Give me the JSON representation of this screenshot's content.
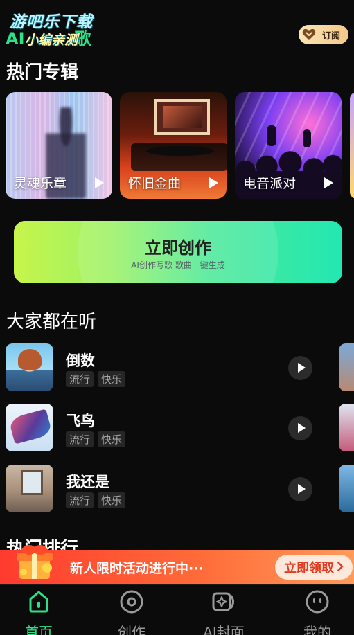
{
  "header": {
    "logo_line1": "游吧乐下载",
    "logo_line2": "AI",
    "logo_line2_suffix": "歌",
    "logo_line3": "小编亲测",
    "subscribe_label": "订阅"
  },
  "albums_section": {
    "title": "热门专辑",
    "items": [
      {
        "name": "灵魂乐章"
      },
      {
        "name": "怀旧金曲"
      },
      {
        "name": "电音派对"
      }
    ]
  },
  "create_card": {
    "title": "立即创作",
    "subtitle": "AI创作写歌 歌曲一键生成"
  },
  "listening_section": {
    "title": "大家都在听",
    "songs": [
      {
        "title": "倒数",
        "tags": [
          "流行",
          "快乐"
        ]
      },
      {
        "title": "飞鸟",
        "tags": [
          "流行",
          "快乐"
        ]
      },
      {
        "title": "我还是",
        "tags": [
          "流行",
          "快乐"
        ]
      }
    ]
  },
  "ranking_section": {
    "title": "热门排行"
  },
  "promo": {
    "text": "新人限时活动进行中···",
    "cta_label": "立即领取"
  },
  "nav": {
    "items": [
      {
        "label": "首页",
        "icon": "home-icon",
        "active": true
      },
      {
        "label": "创作",
        "icon": "disc-icon",
        "active": false
      },
      {
        "label": "AI封面",
        "icon": "ai-cover-icon",
        "active": false
      },
      {
        "label": "我的",
        "icon": "profile-icon",
        "active": false
      }
    ]
  },
  "colors": {
    "accent": "#2de08a",
    "background": "#0b0b0b",
    "promo": "#ff4a32"
  }
}
